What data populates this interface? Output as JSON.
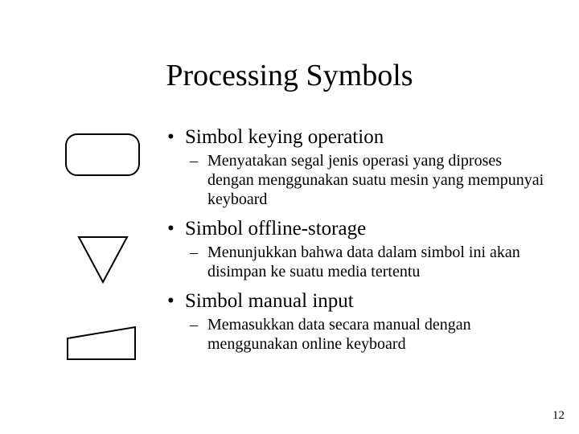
{
  "title": "Processing Symbols",
  "items": [
    {
      "heading": "Simbol keying operation",
      "desc": "Menyatakan segal jenis operasi yang diproses dengan menggunakan suatu mesin yang mempunyai keyboard"
    },
    {
      "heading": "Simbol offline-storage",
      "desc": "Menunjukkan bahwa data dalam simbol ini akan disimpan ke suatu media tertentu"
    },
    {
      "heading": "Simbol manual input",
      "desc": "Memasukkan data secara manual dengan menggunakan online keyboard"
    }
  ],
  "page_number": "12"
}
